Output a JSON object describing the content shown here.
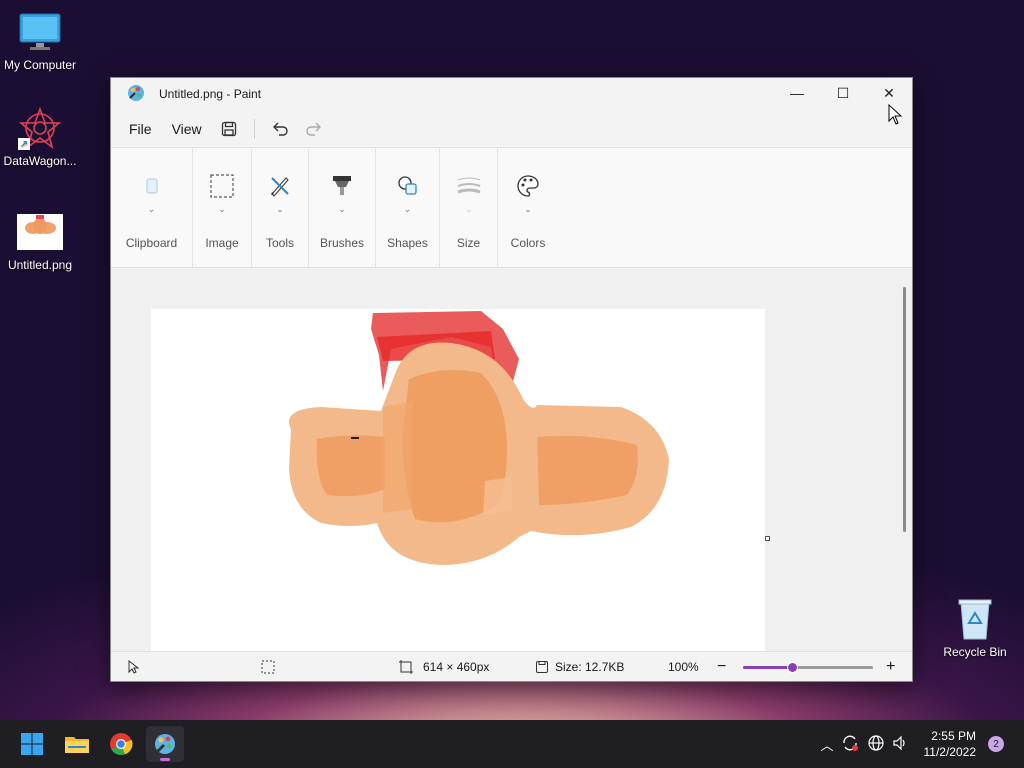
{
  "desktop": {
    "icons": [
      {
        "label": "My Computer"
      },
      {
        "label": "DataWagon..."
      },
      {
        "label": "Untitled.png"
      },
      {
        "label": "Recycle Bin"
      }
    ]
  },
  "window": {
    "title": "Untitled.png - Paint",
    "controls": {
      "minimize": "—",
      "maximize": "☐",
      "close": "✕"
    },
    "menu": {
      "file": "File",
      "view": "View"
    },
    "ribbon": {
      "groups": [
        {
          "label": "Clipboard",
          "icon": "clipboard-icon"
        },
        {
          "label": "Image",
          "icon": "select-icon"
        },
        {
          "label": "Tools",
          "icon": "tools-icon"
        },
        {
          "label": "Brushes",
          "icon": "brush-icon"
        },
        {
          "label": "Shapes",
          "icon": "shapes-icon"
        },
        {
          "label": "Size",
          "icon": "size-icon"
        },
        {
          "label": "Colors",
          "icon": "palette-icon"
        }
      ]
    },
    "status": {
      "dimensions": "614 × 460px",
      "size": "Size: 12.7KB",
      "zoom": "100%",
      "zoom_fraction": 0.38
    }
  },
  "taskbar": {
    "apps": [
      {
        "name": "start",
        "icon": "windows-icon"
      },
      {
        "name": "file-explorer",
        "icon": "folder-icon"
      },
      {
        "name": "chrome",
        "icon": "chrome-icon"
      },
      {
        "name": "paint",
        "icon": "paint-icon",
        "active": true
      }
    ],
    "time": "2:55 PM",
    "date": "11/2/2022",
    "notifications": "2"
  },
  "colors": {
    "accent": "#8a3fb3",
    "taskbar": "#1f1f23"
  }
}
